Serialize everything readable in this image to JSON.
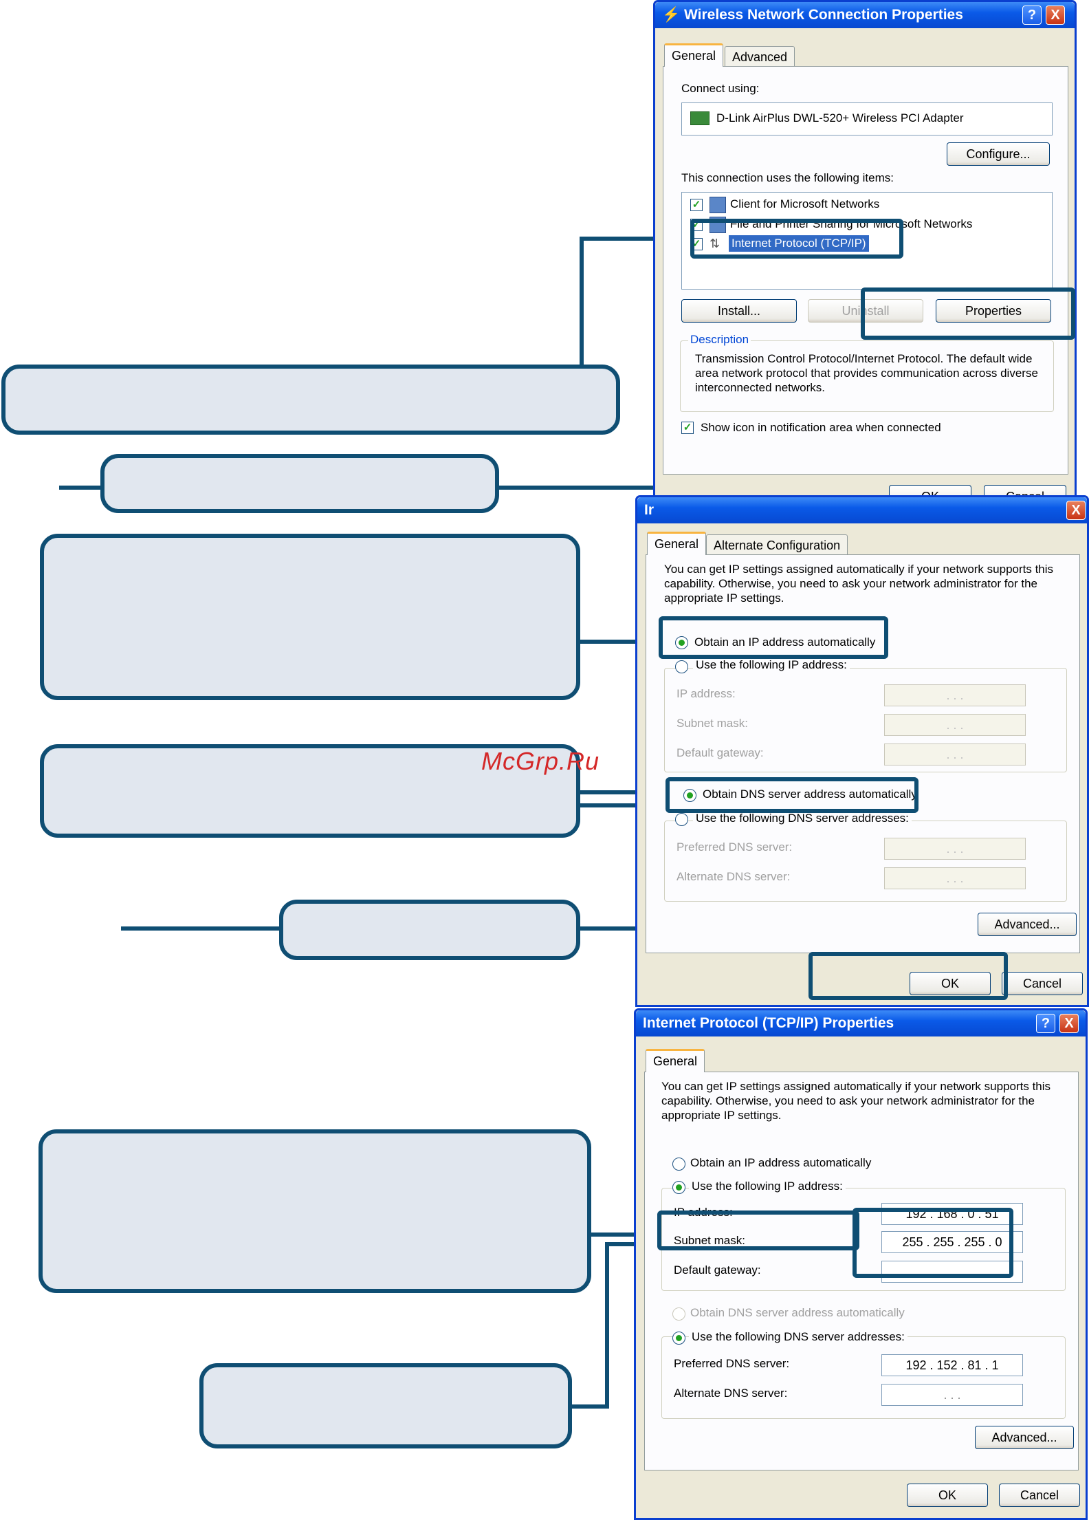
{
  "watermark": "McGrp.Ru",
  "dialog1": {
    "title": "Wireless Network Connection Properties",
    "help": "?",
    "close": "X",
    "tabs": [
      "General",
      "Advanced"
    ],
    "connect_using_label": "Connect using:",
    "adapter": "D-Link AirPlus DWL-520+ Wireless PCI Adapter",
    "configure": "Configure...",
    "items_label": "This connection uses the following items:",
    "items": [
      "Client for Microsoft Networks",
      "File and Printer Sharing for Microsoft Networks",
      "Internet Protocol (TCP/IP)"
    ],
    "install": "Install...",
    "uninstall": "Uninstall",
    "properties": "Properties",
    "description_label": "Description",
    "description": "Transmission Control Protocol/Internet Protocol. The default wide area network protocol that provides communication across diverse interconnected networks.",
    "show_icon": "Show icon in notification area when connected",
    "ok": "OK",
    "cancel": "Cancel"
  },
  "dialog2": {
    "title": "Ir",
    "close": "X",
    "tabs": [
      "General",
      "Alternate Configuration"
    ],
    "intro": "You can get IP settings assigned automatically if your network supports this capability. Otherwise, you need to ask your network administrator for the appropriate IP settings.",
    "obtain_ip": "Obtain an IP address automatically",
    "use_ip": "Use the following IP address:",
    "ip_label": "IP address:",
    "subnet_label": "Subnet mask:",
    "gateway_label": "Default gateway:",
    "empty_ip": ". . .",
    "obtain_dns": "Obtain DNS server address automatically",
    "use_dns": "Use the following DNS server addresses:",
    "pref_dns_label": "Preferred DNS server:",
    "alt_dns_label": "Alternate DNS server:",
    "advanced": "Advanced...",
    "ok": "OK",
    "cancel": "Cancel"
  },
  "dialog3": {
    "title": "Internet Protocol (TCP/IP) Properties",
    "help": "?",
    "close": "X",
    "tabs": [
      "General"
    ],
    "intro": "You can get IP settings assigned automatically if your network supports this capability. Otherwise, you need to ask your network administrator for the appropriate IP settings.",
    "obtain_ip": "Obtain an IP address automatically",
    "use_ip": "Use the following IP address:",
    "ip_label": "IP address:",
    "ip_value": "192 . 168 . 0 . 51",
    "subnet_label": "Subnet mask:",
    "subnet_value": "255 . 255 . 255 . 0",
    "gateway_label": "Default gateway:",
    "empty_ip": ". . .",
    "obtain_dns": "Obtain DNS server address automatically",
    "use_dns": "Use the following DNS server addresses:",
    "pref_dns_label": "Preferred DNS server:",
    "pref_dns_value": "192 . 152 . 81 . 1",
    "alt_dns_label": "Alternate DNS server:",
    "advanced": "Advanced...",
    "ok": "OK",
    "cancel": "Cancel"
  },
  "colors": {
    "callout_border": "#0f4e73",
    "callout_fill": "#e1e7ef",
    "xp_title": "#0a5ae8"
  }
}
